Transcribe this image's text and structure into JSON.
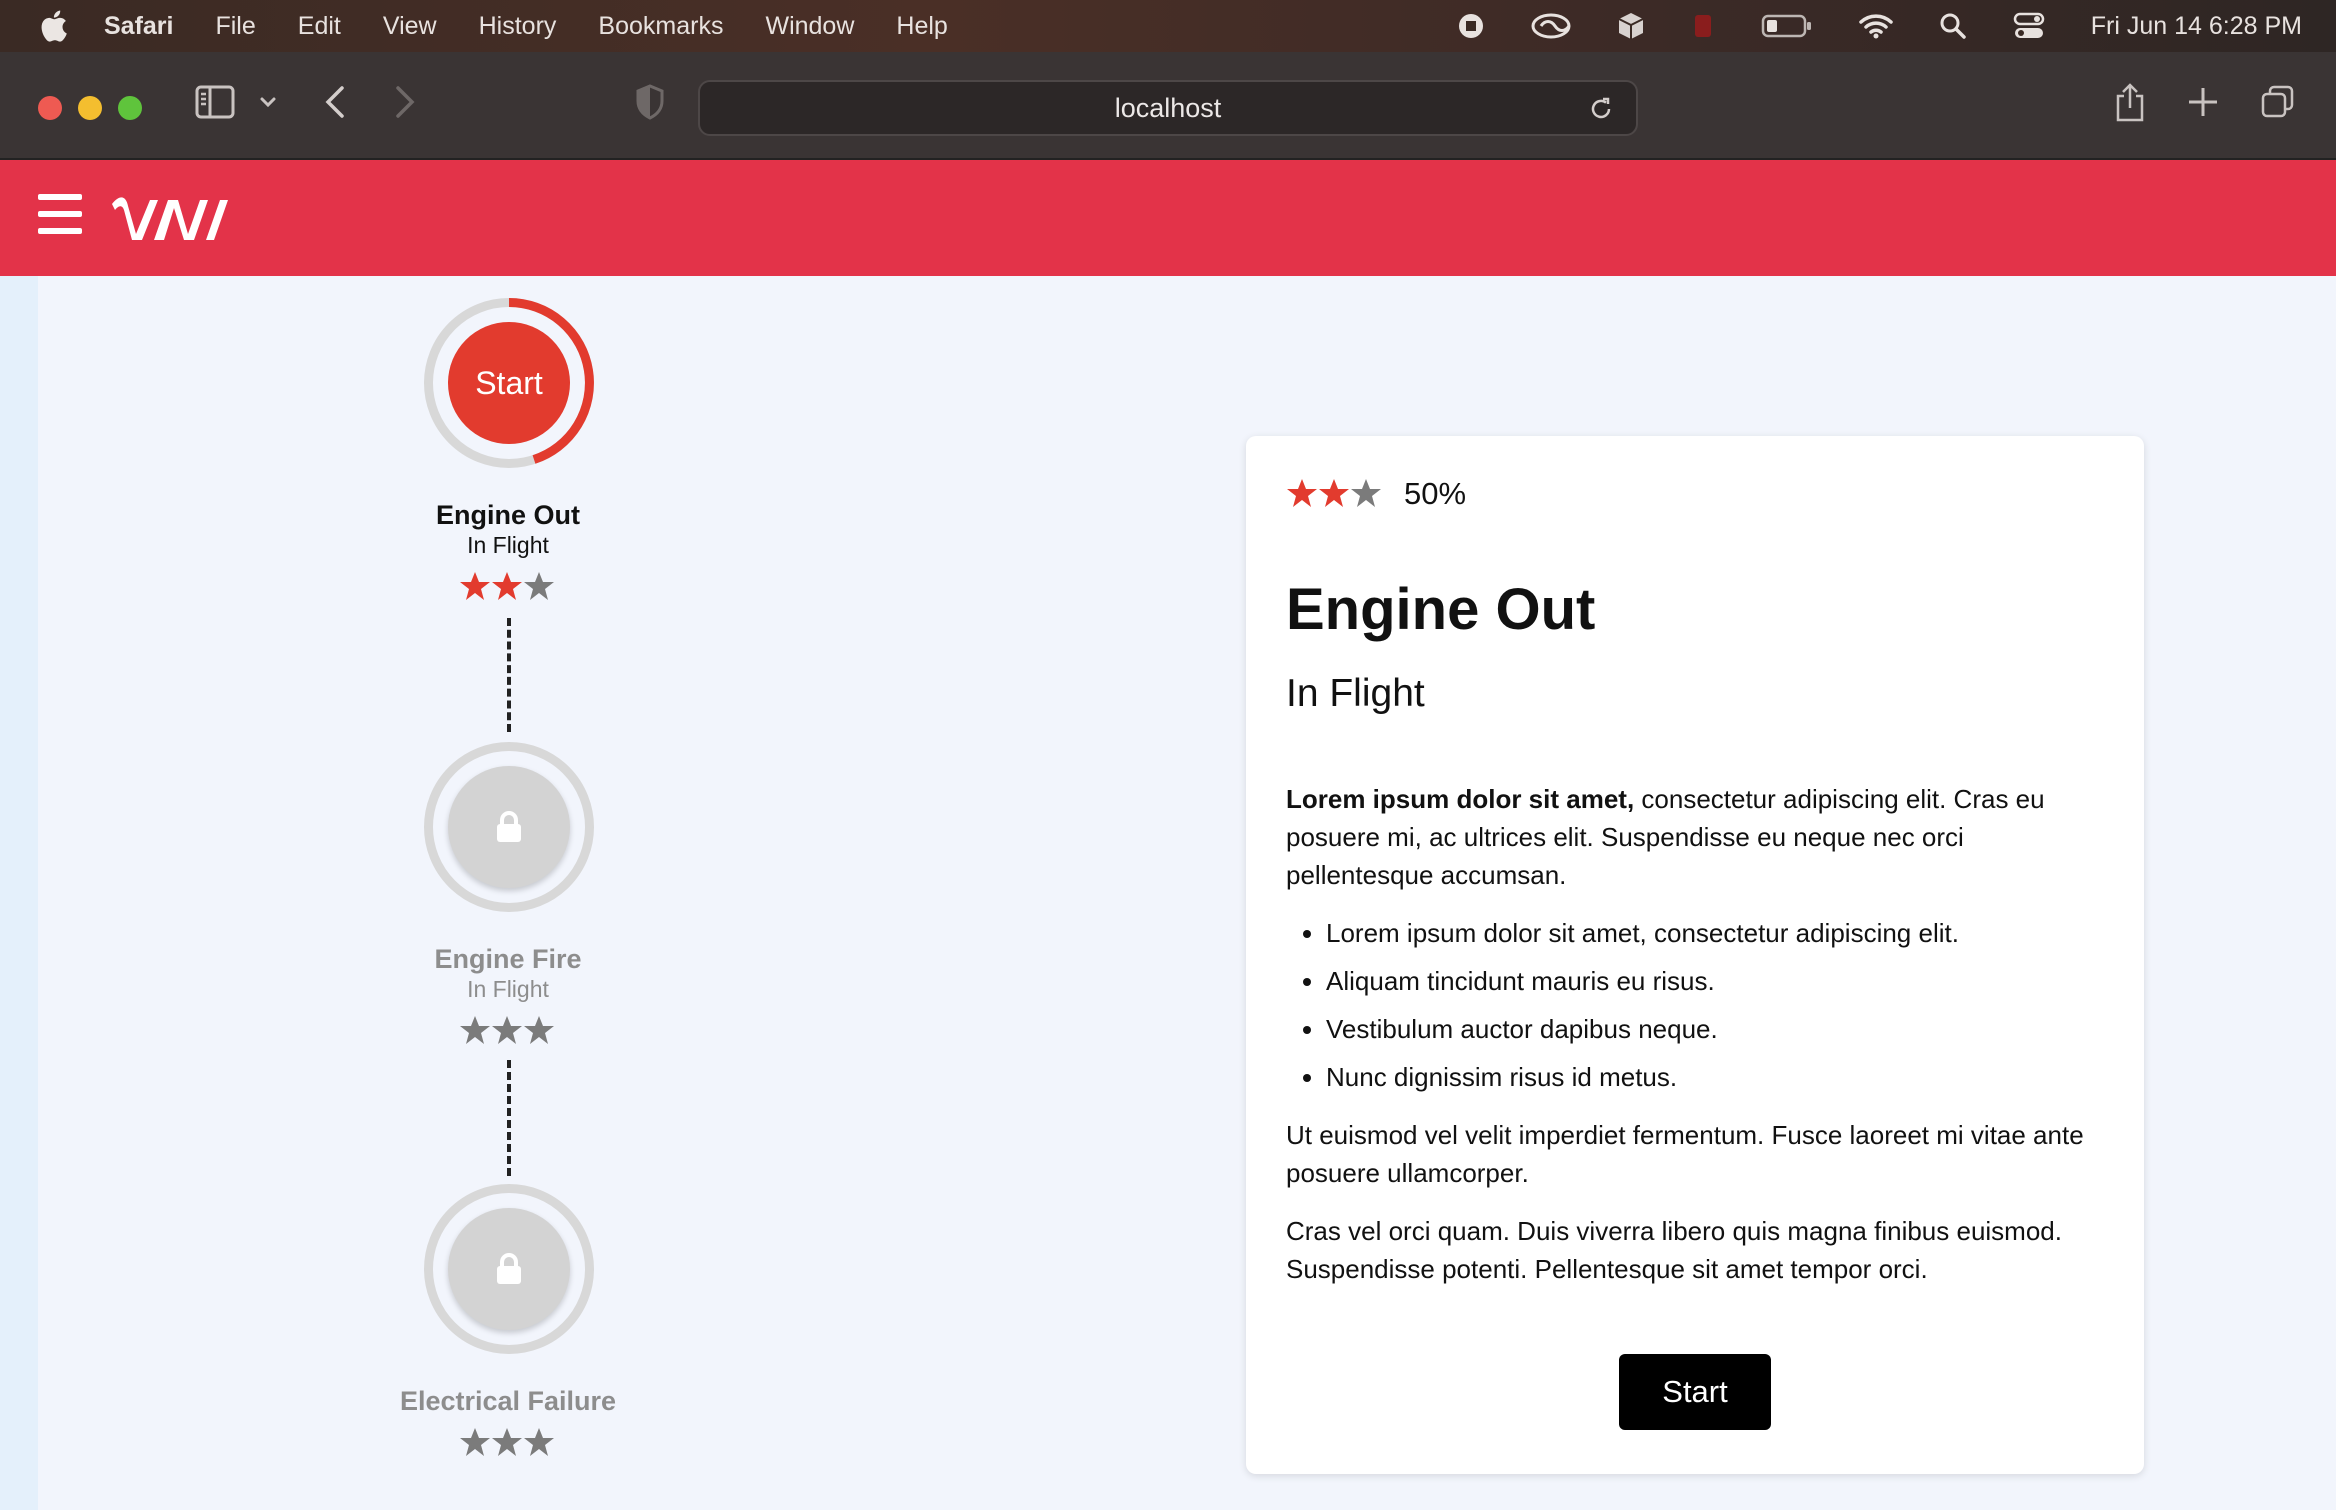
{
  "menubar": {
    "app_name": "Safari",
    "items": [
      "File",
      "Edit",
      "View",
      "History",
      "Bookmarks",
      "Window",
      "Help"
    ],
    "clock": "Fri Jun 14  6:28 PM"
  },
  "browser": {
    "url": "localhost"
  },
  "app": {
    "logo_alt": "VAVI"
  },
  "path": {
    "nodes": [
      {
        "title": "Engine Out",
        "subtitle": "In Flight",
        "stars_earned": 2,
        "stars_total": 3,
        "state": "active",
        "button_label": "Start"
      },
      {
        "title": "Engine Fire",
        "subtitle": "In Flight",
        "stars_earned": 0,
        "stars_total": 3,
        "state": "locked"
      },
      {
        "title": "Electrical Failure",
        "subtitle": "",
        "stars_earned": 0,
        "stars_total": 3,
        "state": "locked"
      }
    ]
  },
  "detail": {
    "stars_earned": 2,
    "stars_total": 3,
    "percent": "50%",
    "title": "Engine Out",
    "subtitle": "In Flight",
    "intro_bold": "Lorem ipsum dolor sit amet,",
    "intro_rest": " consectetur adipiscing elit. Cras eu posuere mi, ac ultrices elit. Suspendisse eu neque nec orci pellentesque accumsan.",
    "bullets": [
      "Lorem ipsum dolor sit amet, consectetur adipiscing elit.",
      "Aliquam tincidunt mauris eu risus.",
      "Vestibulum auctor dapibus neque.",
      "Nunc dignissim risus id metus."
    ],
    "para2": "Ut euismod vel velit imperdiet fermentum. Fusce laoreet mi vitae ante posuere ullamcorper.",
    "para3": "Cras vel orci quam. Duis viverra libero quis magna finibus euismod. Suspendisse potenti. Pellentesque sit amet tempor orci.",
    "start_label": "Start"
  },
  "colors": {
    "accent": "#e33349",
    "star_on": "#e23b2e",
    "star_off": "#7b7b7b"
  }
}
